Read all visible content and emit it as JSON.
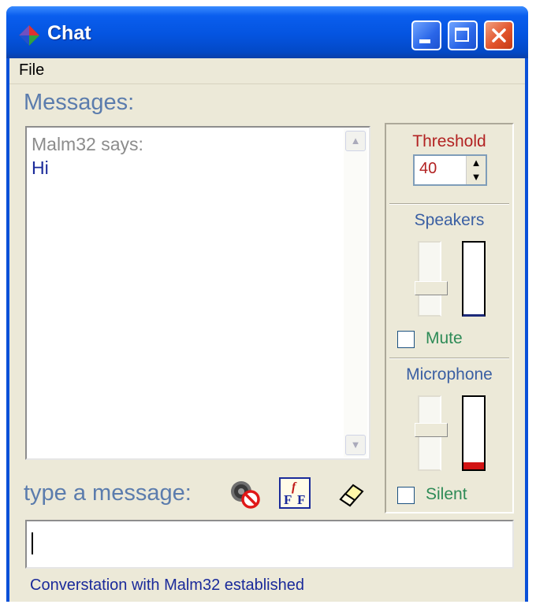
{
  "window": {
    "title": "Chat",
    "app_icon": "app-diamond-icon",
    "controls": [
      "minimize-icon",
      "maximize-icon",
      "close-icon"
    ]
  },
  "menu": {
    "items": [
      {
        "label": "File"
      }
    ]
  },
  "messages": {
    "label": "Messages:",
    "entries": [
      {
        "sender_line": "Malm32 says:",
        "text": "Hi"
      }
    ]
  },
  "compose": {
    "label": "type a message:",
    "icons": [
      "mute-speaker-icon",
      "font-style-icon",
      "eraser-icon"
    ],
    "value": ""
  },
  "threshold": {
    "label": "Threshold",
    "value": "40"
  },
  "speakers": {
    "label": "Speakers",
    "slider_level": 0.35,
    "meter_level": 0.0,
    "mute_label": "Mute",
    "mute_checked": false
  },
  "microphone": {
    "label": "Microphone",
    "slider_level": 0.55,
    "meter_level": 0.1,
    "silent_label": "Silent",
    "silent_checked": false
  },
  "status": {
    "text": "Converstation with Malm32 established"
  },
  "colors": {
    "titlebar": "#0454e0",
    "face": "#ece9d8",
    "label_blue": "#5b7cad",
    "threshold_red": "#b22222",
    "check_green": "#2e8b57",
    "meter_red": "#d21414",
    "meter_border": "#1c2a7a"
  }
}
